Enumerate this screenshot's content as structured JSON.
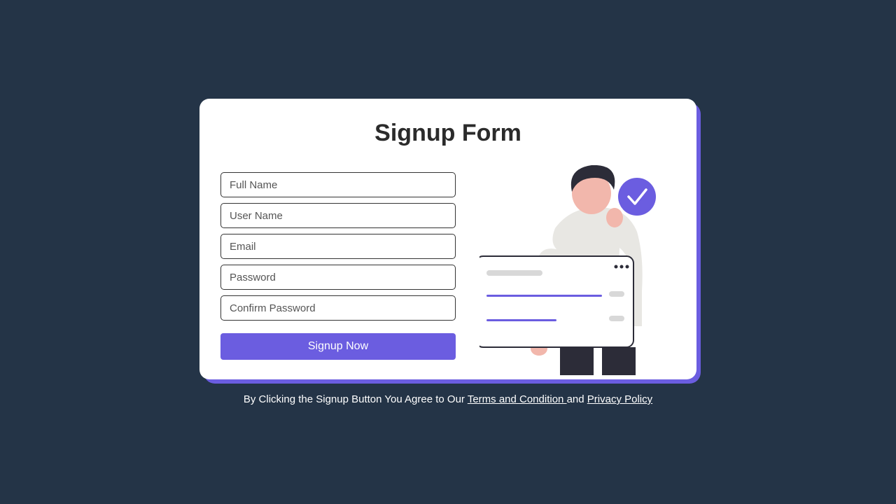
{
  "title": "Signup Form",
  "fields": {
    "full_name": {
      "placeholder": "Full Name"
    },
    "user_name": {
      "placeholder": "User Name"
    },
    "email": {
      "placeholder": "Email"
    },
    "password": {
      "placeholder": "Password"
    },
    "confirm_password": {
      "placeholder": "Confirm Password"
    }
  },
  "button_label": "Signup Now",
  "footer": {
    "prefix": "By Clicking the Signup Button You Agree to Our ",
    "terms_label": "Terms and Condition ",
    "middle": "and ",
    "privacy_label": "Privacy Policy"
  },
  "colors": {
    "accent": "#6b5de0",
    "background": "#243447"
  }
}
